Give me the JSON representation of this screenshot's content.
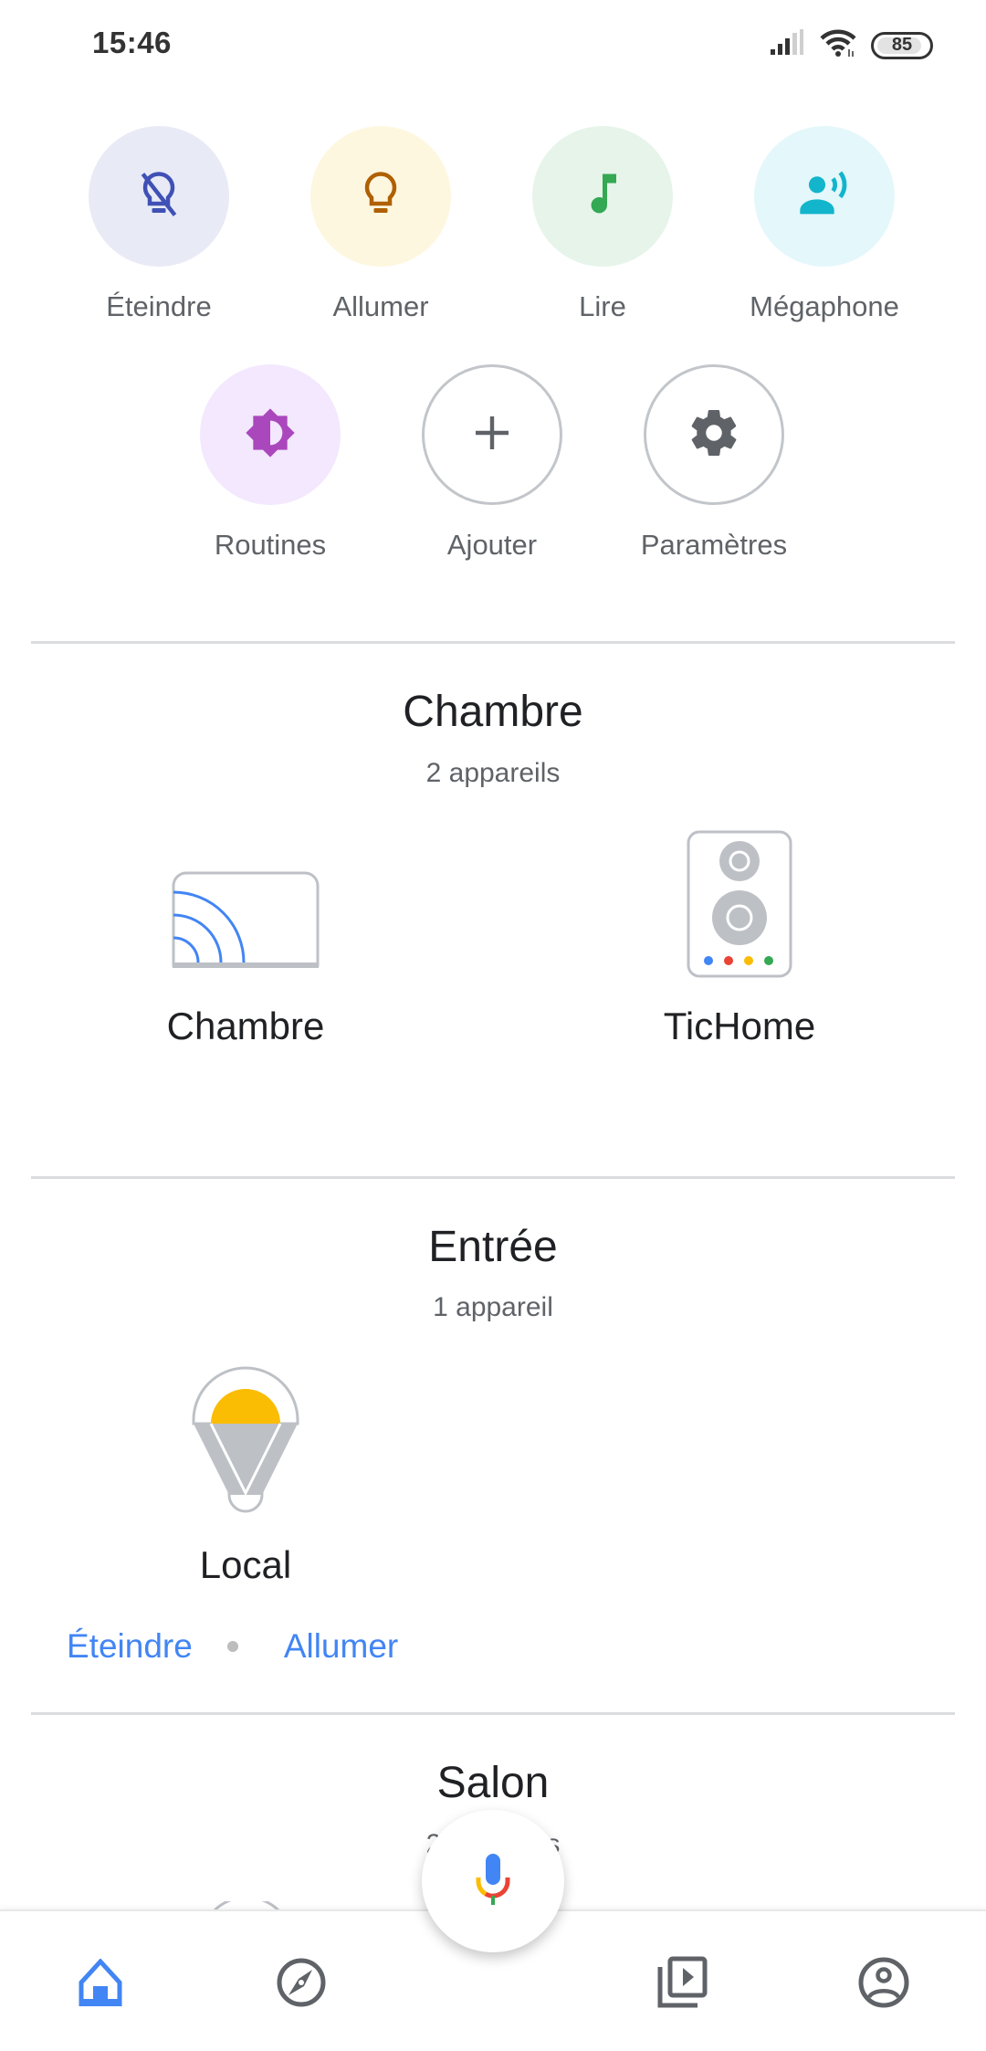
{
  "status_bar": {
    "time": "15:46",
    "battery": "85",
    "battery_level_percent": 85,
    "icons": [
      "signal-icon",
      "wifi-icon",
      "battery-icon"
    ]
  },
  "quick_actions": [
    {
      "label": "Éteindre",
      "icon": "light-off-icon",
      "bg": "#e8eaf6",
      "fg": "#3f51b5"
    },
    {
      "label": "Allumer",
      "icon": "lightbulb-icon",
      "bg": "#fef7e0",
      "fg": "#b06000"
    },
    {
      "label": "Lire",
      "icon": "music-note-icon",
      "bg": "#e6f4ea",
      "fg": "#34a853"
    },
    {
      "label": "Mégaphone",
      "icon": "broadcast-icon",
      "bg": "#e4f7fb",
      "fg": "#12b5cb"
    },
    {
      "label": "Routines",
      "icon": "routines-icon",
      "bg": "#f3e8fd",
      "fg": "#a142f4"
    },
    {
      "label": "Ajouter",
      "icon": "plus-icon",
      "bg": "#ffffff",
      "fg": "#5f6368"
    },
    {
      "label": "Paramètres",
      "icon": "gear-icon",
      "bg": "#ffffff",
      "fg": "#5f6368"
    }
  ],
  "rooms": [
    {
      "name": "Chambre",
      "device_count": "2 appareils",
      "devices": [
        {
          "label": "Chambre",
          "icon": "chromecast-tv-icon"
        },
        {
          "label": "TicHome",
          "icon": "speaker-icon"
        }
      ]
    },
    {
      "name": "Entrée",
      "device_count": "1 appareil",
      "devices": [
        {
          "label": "Local",
          "icon": "light-bulb-device-icon"
        }
      ],
      "actions": [
        "Éteindre",
        "Allumer"
      ]
    },
    {
      "name": "Salon",
      "device_count": "2 appareils"
    }
  ],
  "bottom_nav": {
    "items": [
      {
        "name": "home",
        "icon": "home-icon",
        "active": true
      },
      {
        "name": "discover",
        "icon": "compass-icon",
        "active": false
      },
      {
        "name": "media",
        "icon": "media-library-icon",
        "active": false
      },
      {
        "name": "account",
        "icon": "account-icon",
        "active": false
      }
    ],
    "fab_icon": "microphone-icon"
  },
  "colors": {
    "accent": "#4285f4",
    "text_primary": "#202124",
    "text_secondary": "#5f6368",
    "divider": "#dadce0",
    "icon_gray": "#5f6368",
    "device_gray": "#bdc1c6"
  }
}
